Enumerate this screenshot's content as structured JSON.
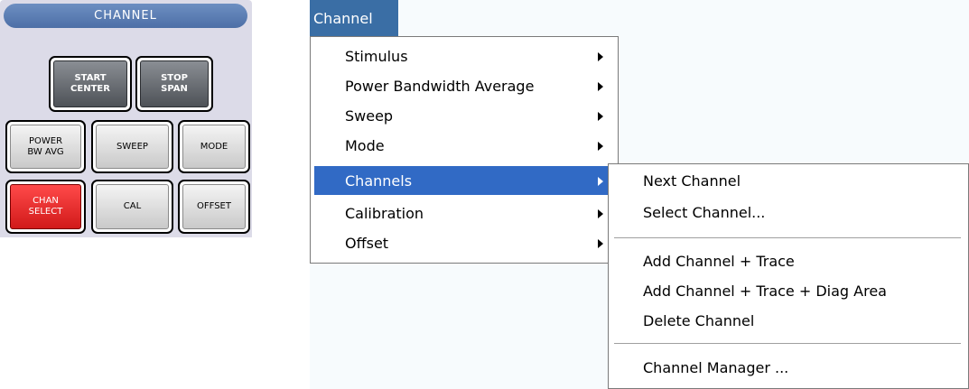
{
  "panel": {
    "title": "CHANNEL",
    "buttons": {
      "start_center": "START\nCENTER",
      "stop_span": "STOP\nSPAN",
      "power_bw_avg": "POWER\nBW AVG",
      "sweep": "SWEEP",
      "mode": "MODE",
      "chan_select": "CHAN\nSELECT",
      "cal": "CAL",
      "offset": "OFFSET"
    }
  },
  "menubar": {
    "channel": "Channel"
  },
  "menu": {
    "items": [
      {
        "label": "Stimulus"
      },
      {
        "label": "Power Bandwidth Average"
      },
      {
        "label": "Sweep"
      },
      {
        "label": "Mode"
      },
      {
        "label": "Channels"
      },
      {
        "label": "Calibration"
      },
      {
        "label": "Offset"
      }
    ],
    "active_item": "Channels"
  },
  "submenu": {
    "items": [
      {
        "label": "Next Channel"
      },
      {
        "label": "Select Channel..."
      },
      {
        "label": "Add Channel + Trace"
      },
      {
        "label": "Add Channel + Trace + Diag Area"
      },
      {
        "label": "Delete Channel"
      },
      {
        "label": "Channel Manager ..."
      }
    ]
  },
  "colors": {
    "panel_bg": "#dcdbe8",
    "title_bar": "#4d6fa6",
    "menu_highlight": "#316ac5",
    "menubar_highlight": "#3a6ea5",
    "chan_select_key": "#e02020"
  }
}
